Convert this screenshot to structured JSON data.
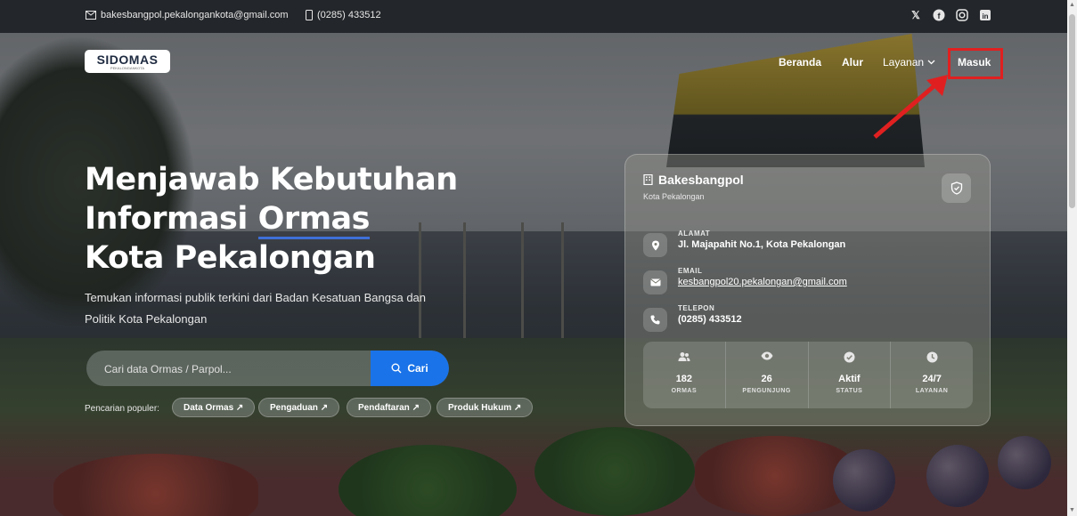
{
  "topbar": {
    "email": "bakesbangpol.pekalongankota@gmail.com",
    "phone": "(0285) 433512",
    "social_icons": [
      "x-icon",
      "facebook-icon",
      "instagram-icon",
      "linkedin-icon"
    ]
  },
  "logo": {
    "text": "SIDOMAS",
    "tagline": "PEKALONGANKOTA"
  },
  "nav": {
    "beranda": "Beranda",
    "alur": "Alur",
    "layanan": "Layanan",
    "masuk": "Masuk"
  },
  "hero": {
    "line1": "Menjawab Kebutuhan",
    "line2a": "Informasi ",
    "line2b": "Ormas",
    "line3": "Kota Pekalongan",
    "subtitle": "Temukan informasi publik terkini dari Badan Kesatuan Bangsa dan Politik Kota Pekalongan"
  },
  "search": {
    "placeholder": "Cari data Ormas / Parpol...",
    "button": "Cari"
  },
  "popular": {
    "label": "Pencarian populer:",
    "chips": [
      "Data Ormas",
      "Pengaduan",
      "Pendaftaran",
      "Produk Hukum"
    ]
  },
  "card": {
    "title": "Bakesbangpol",
    "subtitle": "Kota Pekalongan",
    "address_label": "ALAMAT",
    "address": "Jl. Majapahit No.1, Kota Pekalongan",
    "email_label": "EMAIL",
    "email": "kesbangpol20.pekalongan@gmail.com",
    "phone_label": "TELEPON",
    "phone": "(0285) 433512",
    "stats": [
      {
        "value": "182",
        "label": "ORMAS",
        "icon": "users-icon"
      },
      {
        "value": "26",
        "label": "PENGUNJUNG",
        "icon": "eye-icon"
      },
      {
        "value": "Aktif",
        "label": "STATUS",
        "icon": "check-circle-icon"
      },
      {
        "value": "24/7",
        "label": "LAYANAN",
        "icon": "clock-icon"
      }
    ]
  },
  "colors": {
    "accent": "#1a73e8",
    "highlight_box": "#e02020",
    "underline": "#3f6fd8"
  }
}
